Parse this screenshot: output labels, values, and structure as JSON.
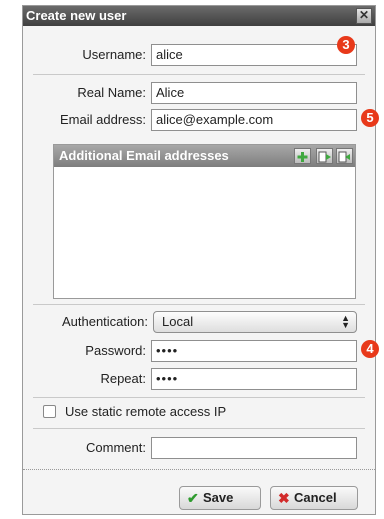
{
  "dialog": {
    "title": "Create new user",
    "close_glyph": "✕"
  },
  "form": {
    "username_label": "Username:",
    "username_value": "alice",
    "realname_label": "Real Name:",
    "realname_value": "Alice",
    "email_label": "Email address:",
    "email_value": "alice@example.com",
    "additional_emails_label": "Additional Email addresses",
    "auth_label": "Authentication:",
    "auth_value": "Local",
    "password_label": "Password:",
    "password_value": "••••",
    "repeat_label": "Repeat:",
    "repeat_value": "••••",
    "static_ip_label": "Use static remote access IP",
    "comment_label": "Comment:",
    "comment_value": ""
  },
  "badges": {
    "username": "3",
    "email": "5",
    "password": "4"
  },
  "buttons": {
    "save_label": "Save",
    "cancel_label": "Cancel"
  },
  "colors": {
    "badge": "#e8391a",
    "save_icon": "#2e9b2e",
    "cancel_icon": "#d22a2a",
    "add_icon": "#3fa83f"
  },
  "icons": {
    "add": "plus-icon",
    "import": "import-icon",
    "export": "export-icon",
    "save": "checkmark-icon",
    "cancel": "x-icon"
  }
}
